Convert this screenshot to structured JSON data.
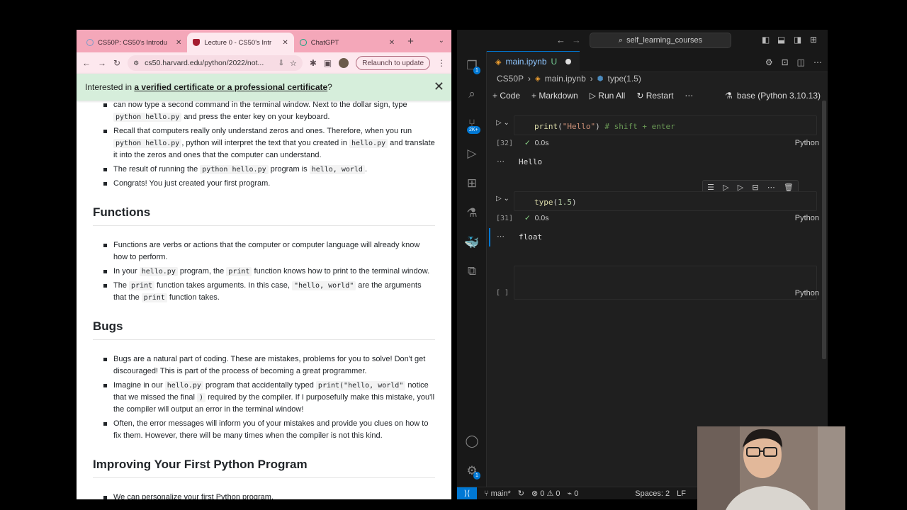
{
  "browser": {
    "tabs": [
      {
        "title": "CS50P: CS50's Introdu",
        "favicon_color": "#7b9cc8"
      },
      {
        "title": "Lecture 0 - CS50's Intr",
        "favicon_color": "#a51c30"
      },
      {
        "title": "ChatGPT",
        "favicon_color": "#10a37f"
      }
    ],
    "url": "cs50.harvard.edu/python/2022/not...",
    "relaunch_label": "Relaunch to update",
    "banner": {
      "prefix": "Interested in ",
      "link": "a verified certificate or a professional certificate",
      "suffix": "?"
    },
    "content": {
      "top_partial": "can now type a second command in the terminal window. Next to the dollar sign, type",
      "top_code": "python hello.py",
      "top_end": " and press the enter key on your keyboard.",
      "intro_items": [
        {
          "a": "Recall that computers really only understand zeros and ones. Therefore, when you run ",
          "code1": "python hello.py",
          "b": ", python will interpret the text that you created in ",
          "code2": "hello.py",
          "c": " and translate it into the zeros and ones that the computer can understand."
        },
        {
          "a": "The result of running the ",
          "code1": "python hello.py",
          "b": " program is ",
          "code2": "hello, world",
          "c": "."
        },
        {
          "a": "Congrats! You just created your first program."
        }
      ],
      "functions_heading": "Functions",
      "functions_items": [
        {
          "a": "Functions are verbs or actions that the computer or computer language will already know how to perform."
        },
        {
          "a": "In your ",
          "code1": "hello.py",
          "b": " program, the ",
          "code2": "print",
          "c": " function knows how to print to the terminal window."
        },
        {
          "a": "The ",
          "code1": "print",
          "b": " function takes arguments. In this case, ",
          "code2": "\"hello, world\"",
          "c": " are the arguments that the ",
          "code3": "print",
          "d": " function takes."
        }
      ],
      "bugs_heading": "Bugs",
      "bugs_items": [
        {
          "a": "Bugs are a natural part of coding. These are mistakes, problems for you to solve! Don't get discouraged! This is part of the process of becoming a great programmer."
        },
        {
          "a": "Imagine in our ",
          "code1": "hello.py",
          "b": " program that accidentally typed ",
          "code2": "print(\"hello, world\"",
          "c": " notice that we missed the final ",
          "code3": ")",
          "d": " required by the compiler. If I purposefully make this mistake, you'll the compiler will output an error in the terminal window!"
        },
        {
          "a": "Often, the error messages will inform you of your mistakes and provide you clues on how to fix them. However, there will be many times when the compiler is not this kind."
        }
      ],
      "improve_heading": "Improving Your First Python Program",
      "improve_items": [
        {
          "a": "We can personalize your first Python program."
        }
      ]
    }
  },
  "vscode": {
    "search_label": "self_learning_courses",
    "editor_tab": "main.ipynb",
    "editor_tab_status": "U",
    "breadcrumbs": [
      "CS50P",
      "main.ipynb",
      "type(1.5)"
    ],
    "nb_toolbar": {
      "code": "Code",
      "markdown": "Markdown",
      "run_all": "Run All",
      "restart": "Restart",
      "more": "⋯",
      "kernel": "base (Python 3.10.13)"
    },
    "cells": [
      {
        "exec": "[32]",
        "time": "0.0s",
        "lang": "Python",
        "output": "Hello"
      },
      {
        "exec": "[31]",
        "time": "0.0s",
        "lang": "Python",
        "output": "float"
      },
      {
        "exec": "[ ]",
        "lang": "Python"
      }
    ],
    "cell1_code": {
      "fn": "print",
      "open": "(",
      "str": "\"Hello\"",
      "close": ")",
      "comment": " # shift + enter"
    },
    "cell2_code": {
      "fn": "type",
      "open": "(",
      "num": "1.5",
      "close": ")"
    },
    "activity_badges": {
      "explorer": "1",
      "extensions": "2K+",
      "accounts": "1"
    },
    "status": {
      "branch": "main*",
      "errors": "0",
      "warnings": "0",
      "ports": "0",
      "spaces": "Spaces: 2",
      "eol": "LF"
    },
    "accent": "#0078d4"
  }
}
